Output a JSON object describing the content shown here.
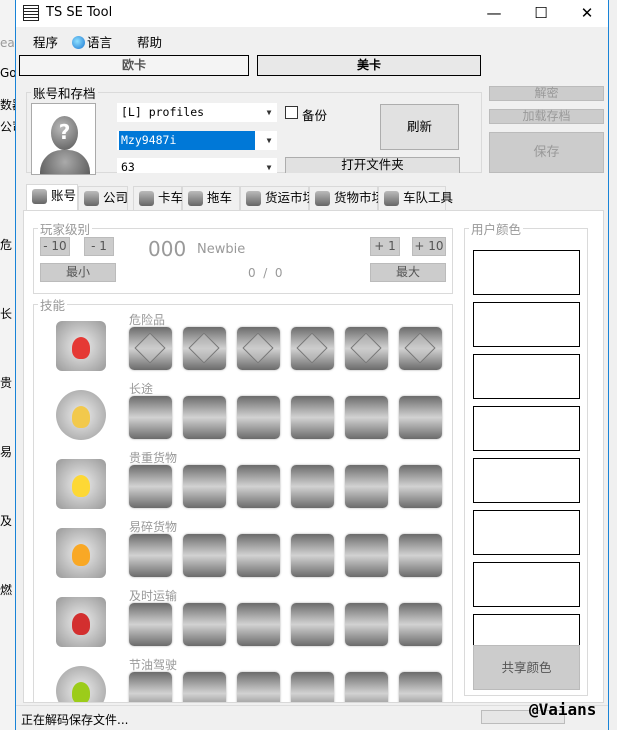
{
  "background_fragments": [
    "ead",
    "Go",
    "数器",
    "公司",
    "危",
    "长",
    "贵",
    "易",
    "及",
    "燃"
  ],
  "window": {
    "title": "TS SE Tool",
    "minimize": "—",
    "maximize": "☐",
    "close": "✕"
  },
  "menu": [
    "程序",
    "语言",
    "帮助"
  ],
  "game_buttons": {
    "ets2": "欧卡",
    "ats": "美卡"
  },
  "profile_group": {
    "title": "账号和存档",
    "profile": "[L] profiles",
    "save": "Mzy9487i",
    "slot": "63",
    "backup_label": "备份",
    "refresh": "刷新",
    "open_folder": "打开文件夹",
    "decode": "解密",
    "load_save": "加载存档",
    "save_button": "保存"
  },
  "tabs": [
    "账号",
    "公司",
    "卡车",
    "拖车",
    "货运市场",
    "货物市场",
    "车队工具"
  ],
  "player_level": {
    "title": "玩家级别",
    "minus10": "- 10",
    "minus1": "- 1",
    "plus1": "+ 1",
    "plus10": "+ 10",
    "min": "最小",
    "max": "最大",
    "level": "000",
    "rank": "Newbie",
    "xp": "0  /  0"
  },
  "skills": {
    "title": "技能",
    "rows": [
      {
        "name": "危险品",
        "color": "#e53935"
      },
      {
        "name": "长途",
        "color": "#f2c94c"
      },
      {
        "name": "贵重货物",
        "color": "#fdd835"
      },
      {
        "name": "易碎货物",
        "color": "#f9a825"
      },
      {
        "name": "及时运输",
        "color": "#d32f2f"
      },
      {
        "name": "节油驾驶",
        "color": "#9ccc1a"
      }
    ]
  },
  "user_colors": {
    "title": "用户颜色",
    "share": "共享颜色",
    "count": 8
  },
  "status": {
    "text": "正在解码保存文件...",
    "watermark": "@Vaians"
  }
}
